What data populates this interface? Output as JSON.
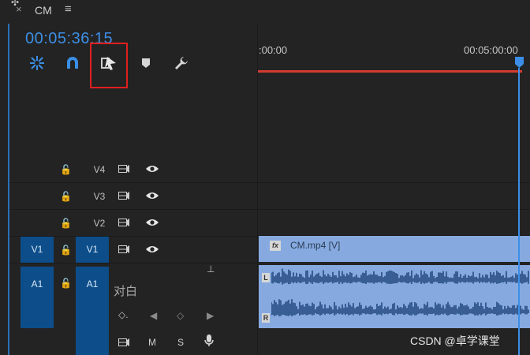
{
  "header": {
    "close_glyph": "×",
    "sequence_name": "CM",
    "menu_glyph": "≡",
    "cursor_glyph": "✣"
  },
  "timecode": "00:05:36:15",
  "toolbar": {
    "icons": [
      "snap-icon",
      "linked-selection-icon",
      "insert-overwrite-icon",
      "marker-icon",
      "wrench-icon"
    ]
  },
  "ruler": {
    "start_label": ":00:00",
    "end_label": "00:05:00:00"
  },
  "tracks": {
    "video": [
      {
        "name": "V4",
        "source": ""
      },
      {
        "name": "V3",
        "source": ""
      },
      {
        "name": "V2",
        "source": ""
      },
      {
        "name": "V1",
        "source": "V1"
      }
    ],
    "audio": [
      {
        "name": "A1",
        "source": "A1",
        "label": "对白",
        "buttons": [
          "M",
          "S"
        ]
      }
    ]
  },
  "clips": {
    "video_clip_label": "CM.mp4 [V]",
    "fx_badge": "fx",
    "audio_left_channel": "L",
    "audio_right_channel": "R"
  },
  "watermark": "CSDN @卓学课堂",
  "colors": {
    "timecode": "#3d8fe6",
    "selected_track": "#0d4e8a",
    "clip": "#86aae0",
    "work_area": "#d43b30",
    "playhead": "#3b8ee8",
    "highlight_box": "#e02020"
  }
}
